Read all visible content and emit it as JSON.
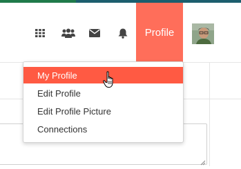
{
  "nav": {
    "icons": [
      "grid-icon",
      "users-icon",
      "envelope-icon",
      "bell-icon"
    ],
    "profile_label": "Profile",
    "accent_color": "#ff6e5a"
  },
  "dropdown": {
    "items": [
      {
        "label": "My Profile",
        "active": true
      },
      {
        "label": "Edit Profile",
        "active": false
      },
      {
        "label": "Edit Profile Picture",
        "active": false
      },
      {
        "label": "Connections",
        "active": false
      }
    ],
    "highlight_color": "#ff5a43"
  }
}
